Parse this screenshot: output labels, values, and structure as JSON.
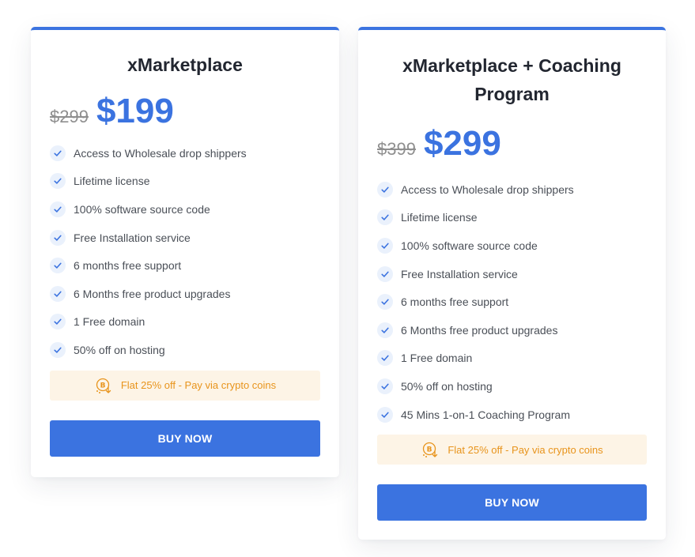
{
  "colors": {
    "accent": "#3b73e0",
    "crypto_text": "#e8941c",
    "crypto_bg": "#fdf4e6",
    "check_bg": "#eaf1fc"
  },
  "plans": [
    {
      "title": "xMarketplace",
      "old_price": "$299",
      "price": "$199",
      "features": [
        "Access to Wholesale drop shippers",
        "Lifetime license",
        "100% software source code",
        "Free Installation service",
        "6 months free support",
        "6 Months free product upgrades",
        "1 Free domain",
        "50% off on hosting"
      ],
      "crypto_offer": "Flat 25% off - Pay via crypto coins",
      "buy_label": "BUY NOW"
    },
    {
      "title": "xMarketplace + Coaching Program",
      "old_price": "$399",
      "price": "$299",
      "features": [
        "Access to Wholesale drop shippers",
        "Lifetime license",
        "100% software source code",
        "Free Installation service",
        "6 months free support",
        "6 Months free product upgrades",
        "1 Free domain",
        "50% off on hosting",
        "45 Mins 1-on-1 Coaching Program"
      ],
      "crypto_offer": "Flat 25% off - Pay via crypto coins",
      "buy_label": "BUY NOW"
    }
  ]
}
